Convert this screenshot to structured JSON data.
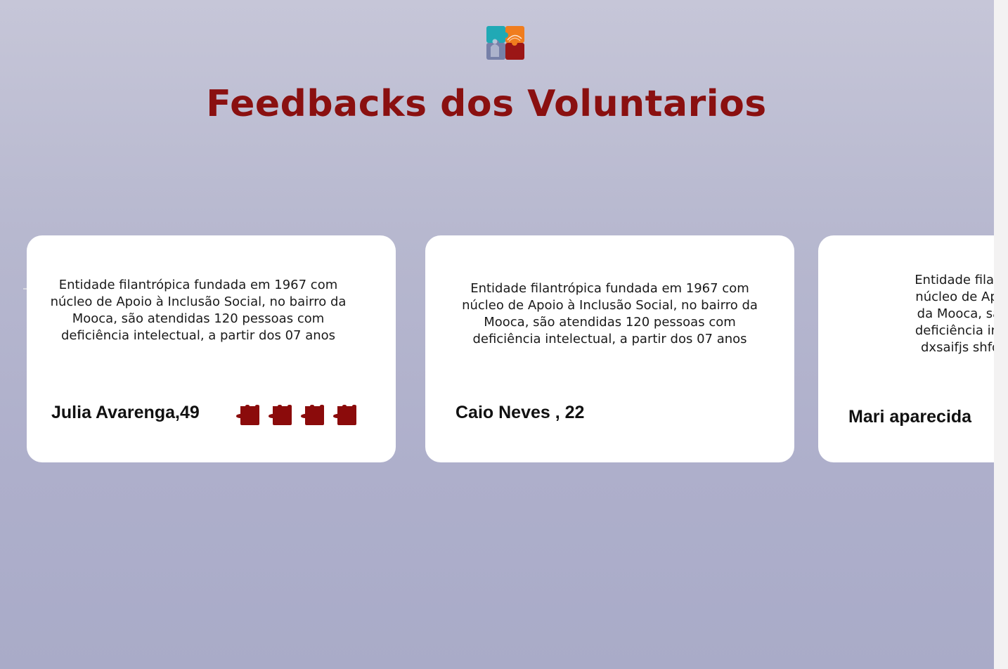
{
  "page": {
    "title": "Feedbacks dos Voluntarios",
    "logo_icon": "puzzle-people-logo-icon",
    "colors": {
      "title": "#8a1010",
      "rating_piece": "#8b0b0b",
      "card_background": "#ffffff"
    }
  },
  "testimonials": [
    {
      "text": "Entidade filantrópica fundada em 1967 com núcleo de Apoio à Inclusão Social, no bairro da Mooca, são atendidas 120 pessoas com deficiência intelectual, a partir dos 07 anos",
      "author": "Julia Avarenga,49",
      "rating": 4,
      "rating_icon": "puzzle-piece-icon"
    },
    {
      "text": "Entidade filantrópica fundada em 1967 com núcleo de Apoio à Inclusão Social, no bairro da Mooca, são atendidas 120 pessoas com deficiência intelectual, a partir dos 07 anos",
      "author": "Caio Neves , 22"
    },
    {
      "text_lines": [
        "Entidade filantrópica fun",
        "núcleo de Apoio à Inclus",
        "da Mooca, são atendida",
        "deficiência intelectual, a",
        "dxsaifjs shfdsujmsoakf"
      ],
      "author": "Mari aparecida"
    }
  ]
}
